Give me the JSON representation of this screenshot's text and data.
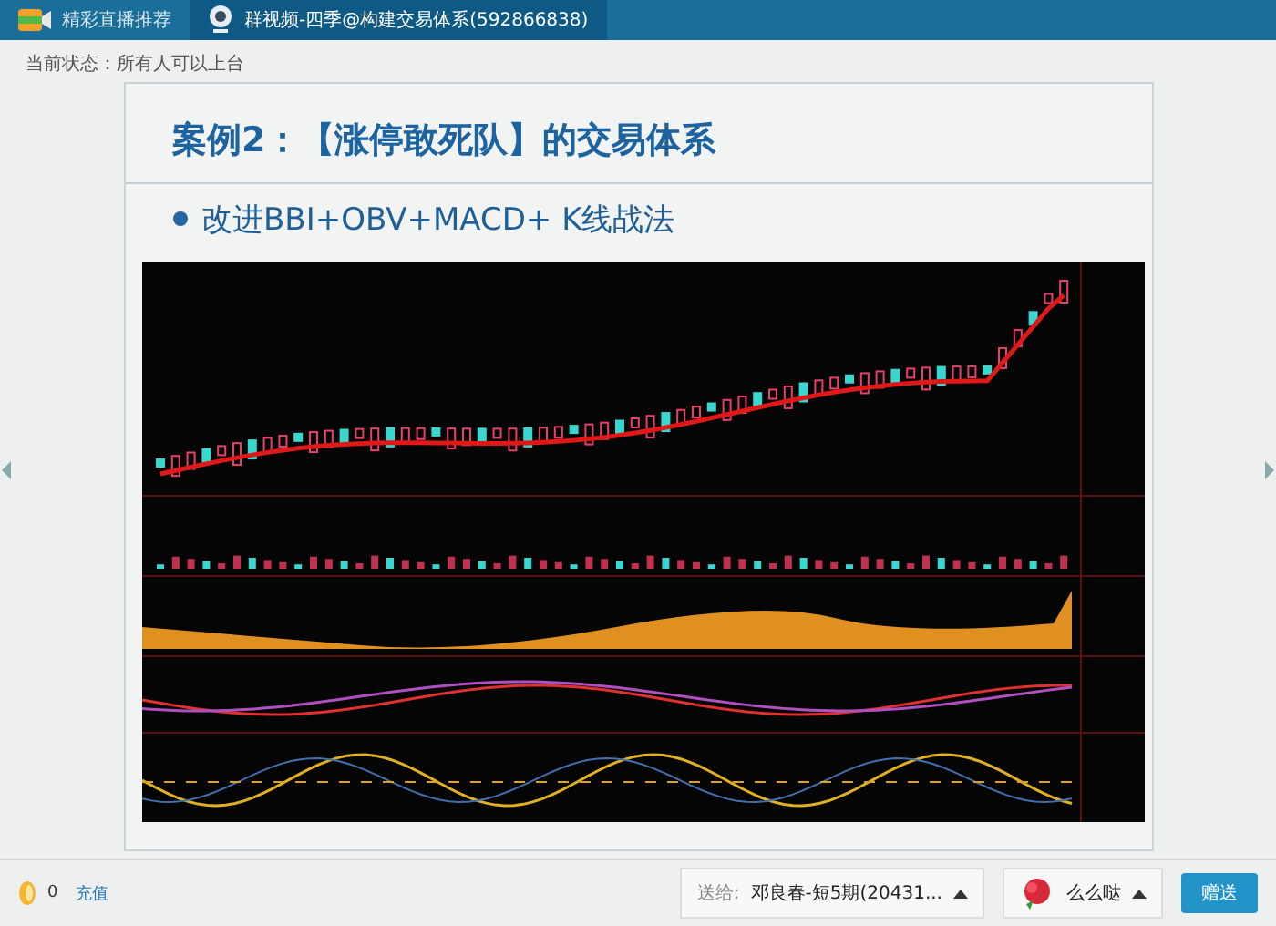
{
  "tabs": [
    {
      "label": "精彩直播推荐",
      "selected": false
    },
    {
      "label": "群视频-四季@构建交易体系(592866838)",
      "selected": true
    }
  ],
  "status": "当前状态：所有人可以上台",
  "slide": {
    "title": "案例2：【涨停敢死队】的交易体系",
    "bullets": [
      "改进BBI+OBV+MACD+ K线战法"
    ]
  },
  "bottom": {
    "coins": "0",
    "recharge": "充值",
    "send_to_label": "送给:",
    "send_to": "邓良春-短5期(20431...",
    "gift": "么么哒",
    "give_button": "赠送"
  }
}
